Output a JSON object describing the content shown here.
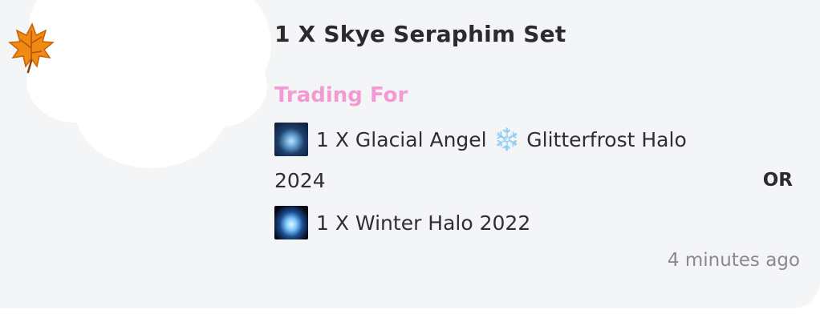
{
  "listing": {
    "title": "1 X Skye Seraphim Set",
    "trading_for_label": "Trading For",
    "trade_items": [
      {
        "text": "1 X Glacial Angel",
        "emoji": "❄️",
        "text_after_emoji": "Glitterfrost Halo",
        "text_continued": "2024",
        "thumbnail": "glacial-angel-halo-thumbnail"
      },
      {
        "text": "1 X Winter Halo 2022",
        "thumbnail": "winter-halo-thumbnail"
      }
    ],
    "or_label": "OR",
    "timestamp": "4 minutes ago"
  },
  "decorations": {
    "leaf_icon": "autumn-leaf-icon",
    "avatar": "redacted-cloud-avatar"
  },
  "colors": {
    "card_background": "#f4f5f7",
    "title": "#2b2b2e",
    "trading_for": "#f39ad3",
    "timestamp": "#8a8a8e",
    "snowflake": "#6fc3f2"
  }
}
